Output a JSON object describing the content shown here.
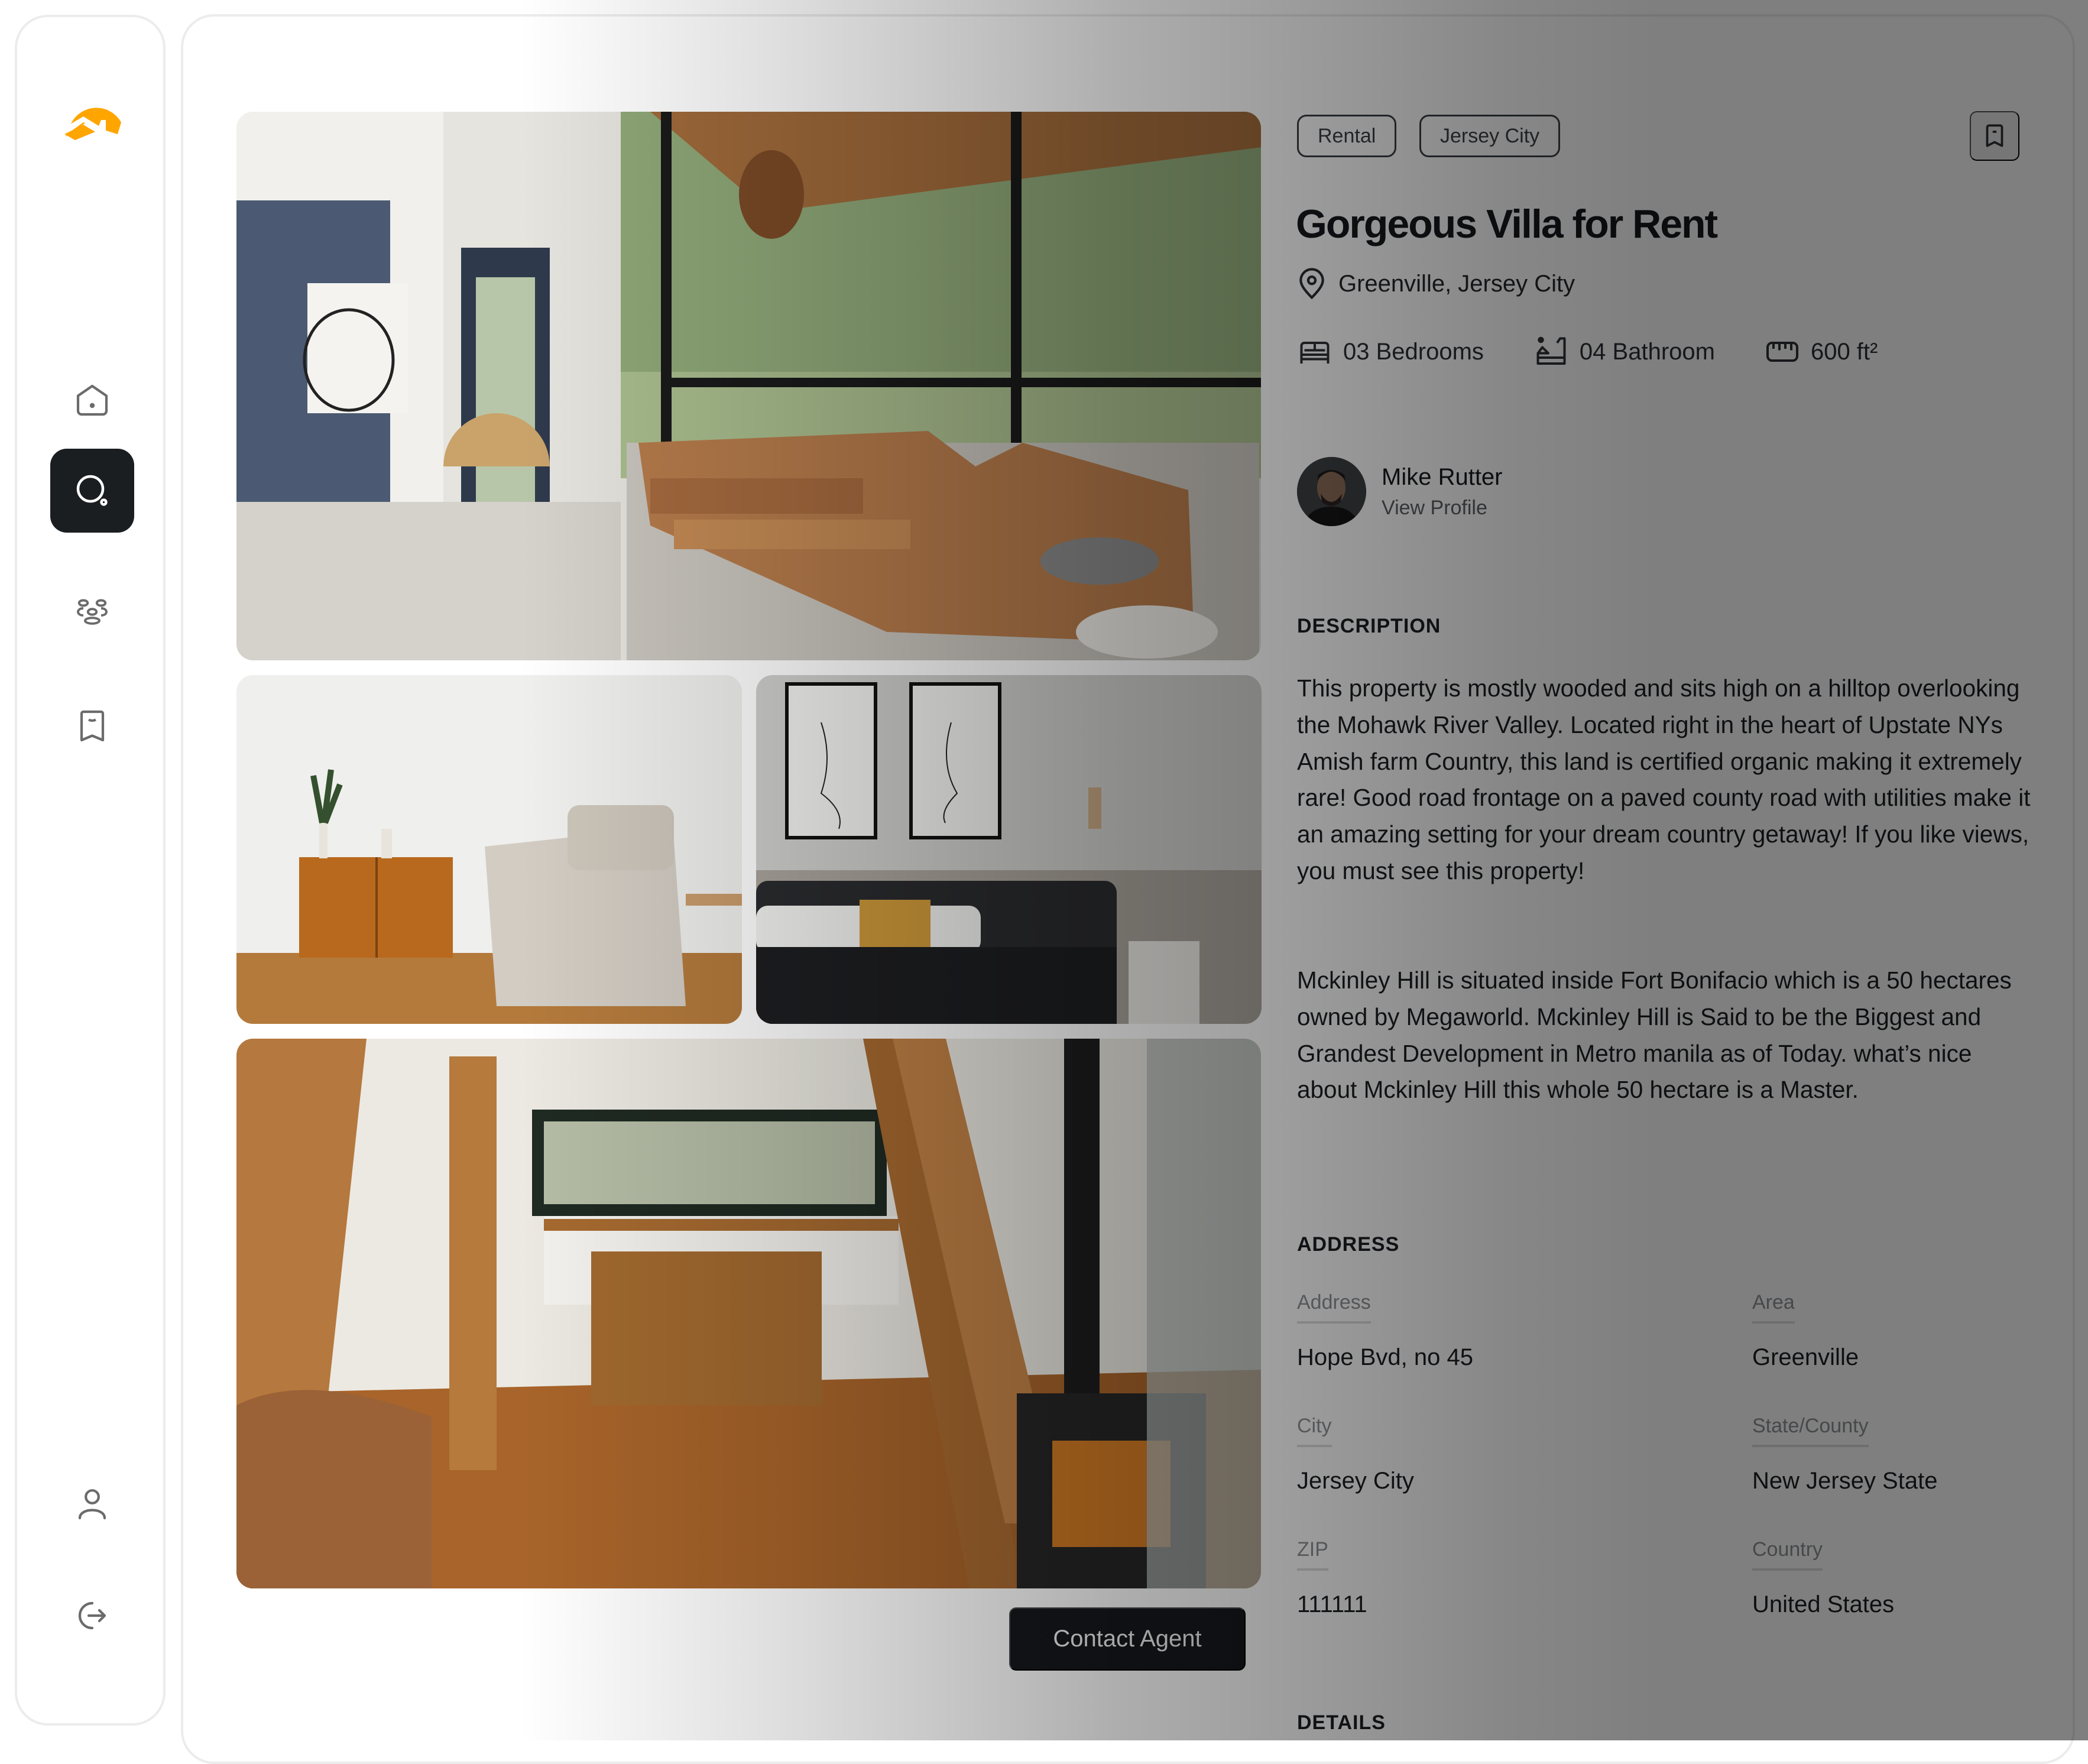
{
  "sidebar": {
    "logo": "brand-logo",
    "brand_color": "#FFA500",
    "items": [
      {
        "id": "home",
        "icon": "home-icon",
        "active": false
      },
      {
        "id": "search",
        "icon": "search-icon",
        "active": true
      },
      {
        "id": "community",
        "icon": "users-group-icon",
        "active": false
      },
      {
        "id": "saved",
        "icon": "bookmark-icon",
        "active": false
      }
    ],
    "bottom_items": [
      {
        "id": "profile",
        "icon": "user-icon"
      },
      {
        "id": "logout",
        "icon": "logout-icon"
      }
    ]
  },
  "gallery": {
    "photos": [
      {
        "id": "living-room",
        "desc": "Living room with leather sectional and large windows"
      },
      {
        "id": "lounge-corner",
        "desc": "Wood cabinet and armchair"
      },
      {
        "id": "bedroom",
        "desc": "Bedroom with line-art frames"
      },
      {
        "id": "kitchen-cabin",
        "desc": "A-frame cabin kitchen with wood stove"
      }
    ],
    "contact_button": "Contact Agent"
  },
  "listing": {
    "tags": [
      "Rental",
      "Jersey City"
    ],
    "title": "Gorgeous Villa for Rent",
    "location": "Greenville, Jersey City",
    "stats": {
      "bedrooms": "03 Bedrooms",
      "bathrooms": "04 Bathroom",
      "area": "600 ft²"
    },
    "agent": {
      "name": "Mike Rutter",
      "link": "View Profile"
    },
    "description": {
      "heading": "DESCRIPTION",
      "paragraphs": [
        "This property is mostly wooded and sits high on a hilltop overlooking the Mohawk River Valley. Located right in the heart of Upstate NYs Amish farm Country, this land is certified organic making it extremely rare! Good road frontage on a paved county road with utilities make it an amazing setting for your dream country getaway! If you like views, you must see this property!",
        "Mckinley Hill is situated inside Fort Bonifacio which is a 50 hectares owned by Megaworld. Mckinley Hill is Said to be the Biggest and Grandest Development in Metro manila as of Today. what’s nice about Mckinley Hill this whole 50 hectare is a Master."
      ]
    },
    "address": {
      "heading": "ADDRESS",
      "fields": [
        {
          "label": "Address",
          "value": "Hope Bvd, no 45"
        },
        {
          "label": "Area",
          "value": "Greenville"
        },
        {
          "label": "City",
          "value": "Jersey City"
        },
        {
          "label": "State/County",
          "value": "New Jersey State"
        },
        {
          "label": "ZIP",
          "value": "111111"
        },
        {
          "label": "Country",
          "value": "United States"
        }
      ]
    },
    "details_heading": "DETAILS"
  }
}
